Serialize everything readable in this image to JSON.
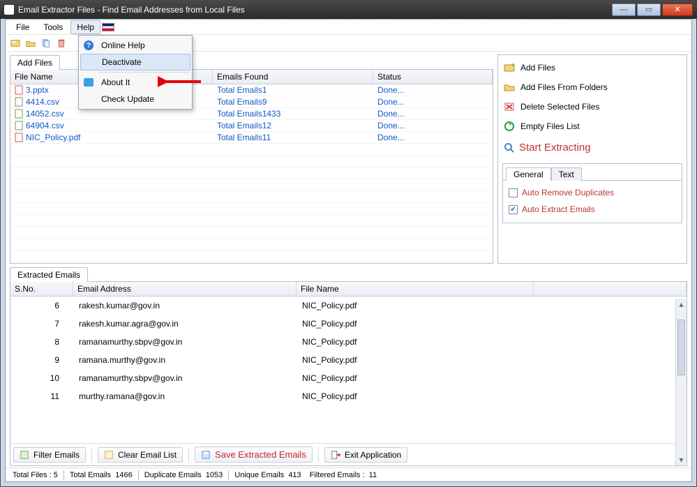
{
  "window": {
    "title": "Email Extractor Files -  Find Email Addresses from Local Files"
  },
  "menus": {
    "file": "File",
    "tools": "Tools",
    "help": "Help"
  },
  "help_menu": {
    "online_help": "Online Help",
    "deactivate": "Deactivate",
    "about": "About It",
    "check_update": "Check Update"
  },
  "files_panel": {
    "tab": "Add Files",
    "headers": {
      "name": "File Name",
      "emails": "Emails Found",
      "status": "Status"
    },
    "rows": [
      {
        "icon": "ppt",
        "name": "3.pptx",
        "emails": "Total Emails1",
        "status": "Done..."
      },
      {
        "icon": "csv",
        "name": "4414.csv",
        "emails": "Total Emails9",
        "status": "Done..."
      },
      {
        "icon": "csv",
        "name": "14052.csv",
        "emails": "Total Emails1433",
        "status": "Done..."
      },
      {
        "icon": "csv",
        "name": "64904.csv",
        "emails": "Total Emails12",
        "status": "Done..."
      },
      {
        "icon": "pdf",
        "name": "NIC_Policy.pdf",
        "emails": "Total Emails11",
        "status": "Done..."
      }
    ]
  },
  "actions": {
    "add_files": "Add Files",
    "add_folders": "Add Files From Folders",
    "delete_selected": "Delete Selected Files",
    "empty_list": "Empty Files List",
    "start": "Start Extracting"
  },
  "options": {
    "tab_general": "General",
    "tab_text": "Text",
    "auto_remove_dup": "Auto Remove Duplicates",
    "auto_extract": "Auto Extract Emails",
    "auto_remove_checked": false,
    "auto_extract_checked": true
  },
  "extracted": {
    "tab": "Extracted Emails",
    "headers": {
      "sno": "S.No.",
      "email": "Email Address",
      "file": "File Name"
    },
    "rows": [
      {
        "sno": "6",
        "email": "rakesh.kumar@gov.in",
        "file": "NIC_Policy.pdf"
      },
      {
        "sno": "7",
        "email": "rakesh.kumar.agra@gov.in",
        "file": "NIC_Policy.pdf"
      },
      {
        "sno": "8",
        "email": "ramanamurthy.sbpv@gov.in",
        "file": "NIC_Policy.pdf"
      },
      {
        "sno": "9",
        "email": "ramana.murthy@gov.in",
        "file": "NIC_Policy.pdf"
      },
      {
        "sno": "10",
        "email": "ramanamurthy.sbpv@gov.in",
        "file": "NIC_Policy.pdf"
      },
      {
        "sno": "11",
        "email": "murthy.ramana@gov.in",
        "file": "NIC_Policy.pdf"
      }
    ]
  },
  "bottom": {
    "filter": "Filter Emails",
    "clear": "Clear Email List",
    "save": "Save Extracted Emails",
    "exit": "Exit Application"
  },
  "status": {
    "total_files_label": "Total Files :",
    "total_files": "5",
    "total_emails_label": "Total Emails",
    "total_emails": "1466",
    "dup_label": "Duplicate Emails",
    "dup": "1053",
    "unique_label": "Unique Emails",
    "unique": "413",
    "filtered_label": "Filtered Emails :",
    "filtered": "11"
  }
}
